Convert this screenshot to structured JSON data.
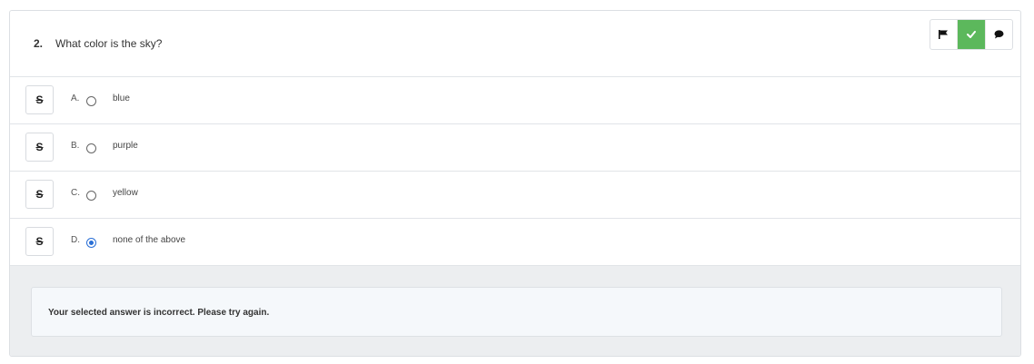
{
  "question": {
    "number": "2.",
    "text": "What color is the sky?"
  },
  "toolbar": {
    "flag_icon": "flag-icon",
    "check_icon": "check-icon",
    "comment_icon": "comment-icon",
    "check_color": "#5cb85c"
  },
  "strike_label": "S",
  "options": [
    {
      "letter": "A.",
      "text": "blue",
      "selected": false
    },
    {
      "letter": "B.",
      "text": "purple",
      "selected": false
    },
    {
      "letter": "C.",
      "text": "yellow",
      "selected": false
    },
    {
      "letter": "D.",
      "text": "none of the above",
      "selected": true
    }
  ],
  "feedback": {
    "message": "Your selected answer is incorrect. Please try again."
  },
  "colors": {
    "accent": "#2a6fd6",
    "feedback_bg": "#eceef0"
  }
}
